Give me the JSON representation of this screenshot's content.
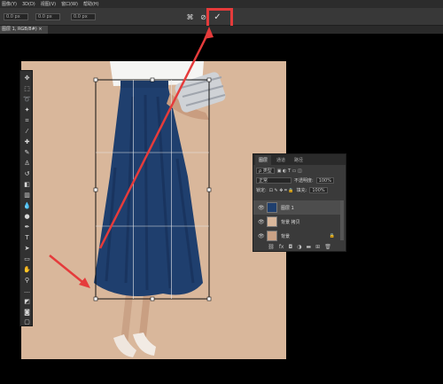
{
  "menubar": {
    "items": [
      "图像(Y)",
      "3D(D)",
      "视图(V)",
      "窗口(W)",
      "帮助(H)"
    ]
  },
  "options": {
    "field1": "0.0 px",
    "field2": "0.0 px",
    "field3": "0.0 px"
  },
  "document": {
    "tab_label": "图层 1, RGB/8#) ×"
  },
  "layers_panel": {
    "tabs": [
      "图层",
      "通道",
      "路径"
    ],
    "filter_label": "ρ 类型",
    "blend_mode": "正常",
    "opacity_label": "不透明度:",
    "opacity_value": "100%",
    "lock_label": "锁定:",
    "fill_label": "填充:",
    "fill_value": "100%",
    "layers": [
      {
        "name": "图层 1"
      },
      {
        "name": "背景 拷贝"
      },
      {
        "name": "背景"
      }
    ],
    "footer_icons": [
      "link-icon",
      "fx-icon",
      "mask-icon",
      "adjust-icon",
      "folder-icon",
      "new-layer-icon",
      "trash-icon"
    ]
  },
  "colors": {
    "accent_red": "#e53b3b",
    "canvas_bg": "#d9b79b",
    "skirt": "#1f3f6e"
  }
}
